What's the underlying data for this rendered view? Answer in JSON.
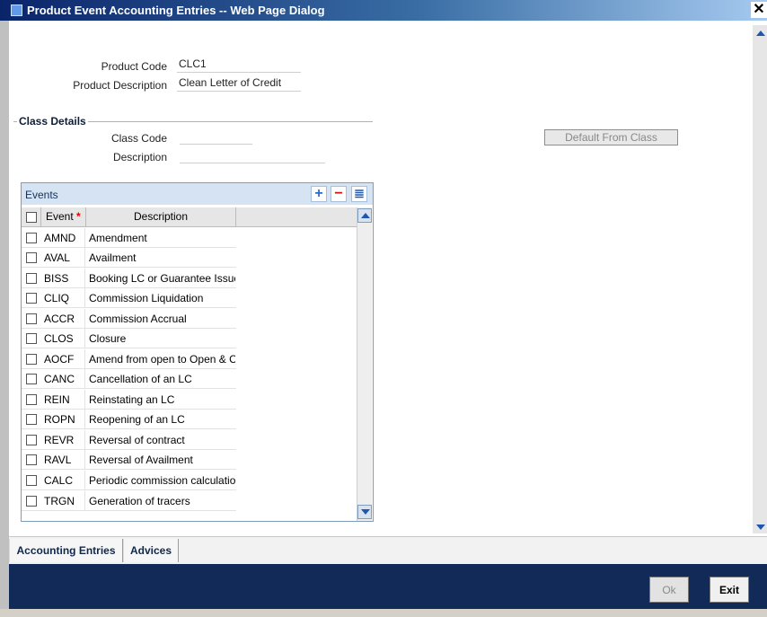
{
  "window": {
    "title": "Product Event Accounting Entries -- Web Page Dialog",
    "close_glyph": "✕"
  },
  "product": {
    "code_label": "Product Code",
    "code_value": "CLC1",
    "desc_label": "Product Description",
    "desc_value": "Clean Letter of Credit"
  },
  "class_details": {
    "title": "Class Details",
    "code_label": "Class Code",
    "code_value": "",
    "desc_label": "Description",
    "desc_value": "",
    "default_button": "Default From Class"
  },
  "events": {
    "title": "Events",
    "add_glyph": "+",
    "remove_glyph": "−",
    "view_glyph": "≣",
    "col_event": "Event",
    "required_mark": "*",
    "col_description": "Description",
    "rows": [
      {
        "code": "AMND",
        "desc": "Amendment"
      },
      {
        "code": "AVAL",
        "desc": "Availment"
      },
      {
        "code": "BISS",
        "desc": "Booking LC or Guarantee Issue"
      },
      {
        "code": "CLIQ",
        "desc": "Commission Liquidation"
      },
      {
        "code": "ACCR",
        "desc": "Commission Accrual"
      },
      {
        "code": "CLOS",
        "desc": "Closure"
      },
      {
        "code": "AOCF",
        "desc": "Amend from open to Open & Co"
      },
      {
        "code": "CANC",
        "desc": "Cancellation of an LC"
      },
      {
        "code": "REIN",
        "desc": "Reinstating an LC"
      },
      {
        "code": "ROPN",
        "desc": "Reopening of an LC"
      },
      {
        "code": "REVR",
        "desc": "Reversal of contract"
      },
      {
        "code": "RAVL",
        "desc": "Reversal of Availment"
      },
      {
        "code": "CALC",
        "desc": "Periodic commission calculation"
      },
      {
        "code": "TRGN",
        "desc": "Generation of tracers"
      }
    ]
  },
  "tabs": [
    {
      "label": "Accounting Entries"
    },
    {
      "label": "Advices"
    }
  ],
  "footer": {
    "ok_label": "Ok",
    "exit_label": "Exit"
  }
}
